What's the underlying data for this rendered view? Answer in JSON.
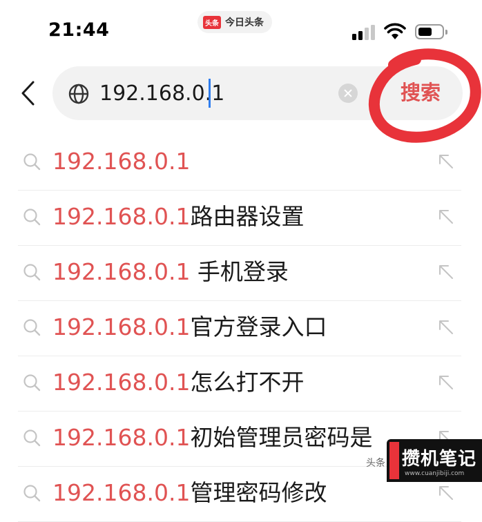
{
  "status_bar": {
    "time": "21:44",
    "app_badge": "头条",
    "app_name": "今日头条"
  },
  "search": {
    "value": "192.168.0.1",
    "button_label": "搜索",
    "annotation_color": "#e8333a"
  },
  "suggestions": [
    {
      "highlight": "192.168.0.1",
      "rest": ""
    },
    {
      "highlight": "192.168.0.1",
      "rest": "路由器设置"
    },
    {
      "highlight": "192.168.0.1",
      "rest": " 手机登录"
    },
    {
      "highlight": "192.168.0.1",
      "rest": "官方登录入口"
    },
    {
      "highlight": "192.168.0.1",
      "rest": "怎么打不开"
    },
    {
      "highlight": "192.168.0.1",
      "rest": "初始管理员密码是"
    },
    {
      "highlight": "192.168.0.1",
      "rest": "管理密码修改"
    }
  ],
  "watermark": {
    "small_text": "头条",
    "title": "攒机笔记",
    "url": "www.cuanjibiji.com"
  },
  "colors": {
    "highlight": "#e05353",
    "accent": "#2f7dee"
  }
}
